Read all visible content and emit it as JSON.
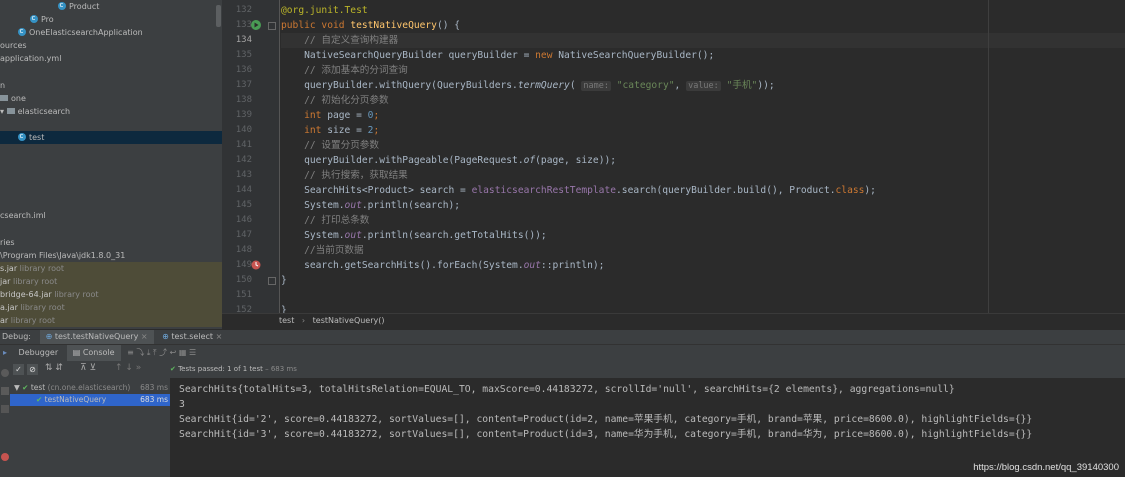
{
  "project_tree": {
    "rows": [
      {
        "label": "Product",
        "icon": "class-icon"
      },
      {
        "label": "Pro",
        "icon": "class-icon"
      },
      {
        "label": "OneElasticsearchApplication",
        "icon": "class-icon"
      },
      {
        "label": "ources",
        "icon": ""
      },
      {
        "label": "application.yml",
        "icon": ""
      },
      {
        "label": "n",
        "icon": ""
      },
      {
        "label": "one",
        "icon": "folder-icon"
      },
      {
        "label": "elasticsearch",
        "icon": "folder-icon"
      },
      {
        "label": "test",
        "icon": "class-icon"
      },
      {
        "label": "csearch.iml",
        "icon": ""
      },
      {
        "label": "ries",
        "icon": ""
      },
      {
        "label": "\\Program Files\\Java\\jdk1.8.0_31",
        "icon": ""
      },
      {
        "label": "s.jar",
        "suffix": "library root"
      },
      {
        "label": "jar",
        "suffix": "library root"
      },
      {
        "label": "bridge-64.jar",
        "suffix": "library root"
      },
      {
        "label": "a.jar",
        "suffix": "library root"
      },
      {
        "label": "ar",
        "suffix": "library root"
      }
    ]
  },
  "editor": {
    "current_line": "134",
    "line_numbers": [
      "132",
      "133",
      "134",
      "135",
      "136",
      "137",
      "138",
      "139",
      "140",
      "141",
      "142",
      "143",
      "144",
      "145",
      "146",
      "147",
      "148",
      "149",
      "150",
      "151",
      "152"
    ],
    "code": {
      "l132": "@org.junit.Test",
      "l133_kw": "public void ",
      "l133_fn": "testNativeQuery",
      "l133_rest": "() {",
      "l134": "    // 自定义查询构建器",
      "l135_a": "    NativeSearchQueryBuilder queryBuilder = ",
      "l135_kw": "new ",
      "l135_b": "NativeSearchQueryBuilder();",
      "l136": "    // 添加基本的分词查询",
      "l137_a": "    queryBuilder.withQuery(QueryBuilders.",
      "l137_it": "termQuery",
      "l137_b": "( ",
      "l137_h1": "name:",
      "l137_s1": " \"category\"",
      "l137_c": ", ",
      "l137_h2": "value:",
      "l137_s2": " \"手机\"",
      "l137_d": "));",
      "l138": "    // 初始化分页参数",
      "l139_kw": "    int ",
      "l139_a": "page = ",
      "l139_n": "0",
      "l139_e": ";",
      "l140_kw": "    int ",
      "l140_a": "size = ",
      "l140_n": "2",
      "l140_e": ";",
      "l141": "    // 设置分页参数",
      "l142_a": "    queryBuilder.withPageable(PageRequest.",
      "l142_it": "of",
      "l142_b": "(page, size));",
      "l143": "    // 执行搜索，获取结果",
      "l144_a": "    SearchHits<Product> search = ",
      "l144_f": "elasticsearchRestTemplate",
      "l144_b": ".search(queryBuilder.build(), Product.",
      "l144_kw": "class",
      "l144_c": ");",
      "l145_a": "    System.",
      "l145_f": "out",
      "l145_b": ".println(search);",
      "l146": "    // 打印总条数",
      "l147_a": "    System.",
      "l147_f": "out",
      "l147_b": ".println(search.getTotalHits());",
      "l148": "    //当前页数据",
      "l149_a": "    search.getSearchHits().forEach(System.",
      "l149_f": "out",
      "l149_b": "::println);",
      "l150": "}",
      "l152": "}"
    }
  },
  "breadcrumb": {
    "first": "test",
    "sep": "›",
    "second": "testNativeQuery()"
  },
  "debug_tabs": {
    "label": "Debug:",
    "tab1": "test.testNativeQuery",
    "tab2": "test.select",
    "close": "×"
  },
  "debug_toolbar": {
    "debugger": "Debugger",
    "console": "Console"
  },
  "tests": {
    "status_text": "Tests passed: 1 of 1 test",
    "status_time": "– 683 ms",
    "root_label": "test",
    "root_pkg": "(cn.one.elasticsearch)",
    "root_time": "683 ms",
    "child_label": "testNativeQuery",
    "child_time": "683 ms"
  },
  "console_lines": [
    "SearchHits{totalHits=3, totalHitsRelation=EQUAL_TO, maxScore=0.44183272, scrollId='null', searchHits={2 elements}, aggregations=null}",
    "3",
    "SearchHit{id='2', score=0.44183272, sortValues=[], content=Product(id=2, name=苹果手机, category=手机, brand=苹果, price=8600.0), highlightFields={}}",
    "SearchHit{id='3', score=0.44183272, sortValues=[], content=Product(id=3, name=华为手机, category=手机, brand=华为, price=8600.0), highlightFields={}}"
  ],
  "watermark": "https://blog.csdn.net/qq_39140300",
  "colors": {
    "keyword": "#cc7832",
    "comment": "#808080",
    "string": "#6a8759",
    "annotation": "#bbb529",
    "method": "#ffc66d",
    "field": "#9876aa",
    "number": "#6897bb"
  }
}
